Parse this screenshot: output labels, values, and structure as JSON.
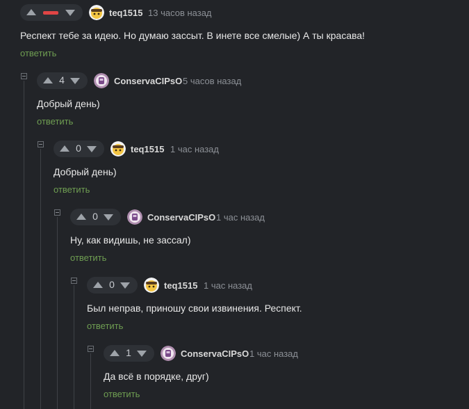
{
  "colors": {
    "background": "#222428",
    "reply_link": "#6f9e52",
    "downvoted_bar": "#e04545",
    "thread_line": "#3f4247"
  },
  "icons": {
    "vote_up": "arrow-up-icon",
    "vote_down": "arrow-down-icon",
    "collapse": "collapse-minus-icon"
  },
  "comments": [
    {
      "author": "teq1515",
      "time": "13 часов назад",
      "score": null,
      "rating_state": "negative-bar",
      "text": "Респект тебе за идею. Но думаю зассыт. В инете все смелые) А ты красава!",
      "reply_label": "ответить",
      "depth": 0
    },
    {
      "author": "ConservaCIPsO",
      "time": "5 часов назад",
      "score": "4",
      "text": "Добрый день)",
      "reply_label": "ответить",
      "depth": 1
    },
    {
      "author": "teq1515",
      "time": "1 час назад",
      "score": "0",
      "text": "Добрый день)",
      "reply_label": "ответить",
      "depth": 2
    },
    {
      "author": "ConservaCIPsO",
      "time": "1 час назад",
      "score": "0",
      "text": "Ну, как видишь, не зассал)",
      "reply_label": "ответить",
      "depth": 3
    },
    {
      "author": "teq1515",
      "time": "1 час назад",
      "score": "0",
      "text": "Был неправ, приношу свои извинения. Респект.",
      "reply_label": "ответить",
      "depth": 4
    },
    {
      "author": "ConservaCIPsO",
      "time": "1 час назад",
      "score": "1",
      "text": "Да всё в порядке, друг)",
      "reply_label": "ответить",
      "depth": 5
    }
  ]
}
